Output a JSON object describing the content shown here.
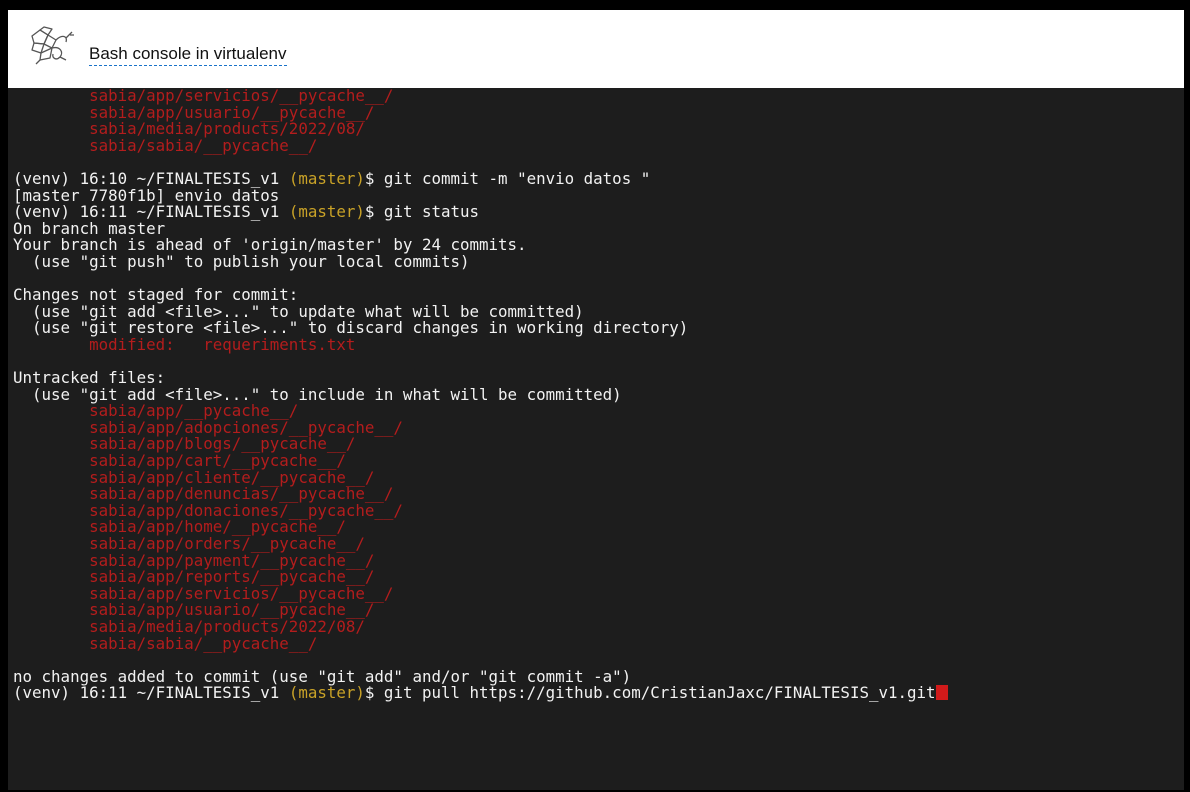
{
  "window": {
    "title": "Bash console in virtualenv",
    "logo_icon": "pythonanywhere-logo-icon"
  },
  "colors": {
    "terminal_bg": "#1d1d1d",
    "text": "#f2f2f2",
    "red": "#b31d1d",
    "yellow": "#c9a227",
    "cursor": "#d11a1a"
  },
  "terminal": {
    "lines": [
      [
        {
          "t": "        sabia/app/servicios/__pycache__/",
          "c": "red"
        }
      ],
      [
        {
          "t": "        sabia/app/usuario/__pycache__/",
          "c": "red"
        }
      ],
      [
        {
          "t": "        sabia/media/products/2022/08/",
          "c": "red"
        }
      ],
      [
        {
          "t": "        sabia/sabia/__pycache__/",
          "c": "red"
        }
      ],
      [],
      [
        {
          "t": "(venv) 16:10 ~/FINALTESIS_v1 "
        },
        {
          "t": "(master)",
          "c": "yellow"
        },
        {
          "t": "$ git commit -m \"envio datos \""
        }
      ],
      [
        {
          "t": "[master 7780f1b] envio datos"
        }
      ],
      [
        {
          "t": "(venv) 16:11 ~/FINALTESIS_v1 "
        },
        {
          "t": "(master)",
          "c": "yellow"
        },
        {
          "t": "$ git status"
        }
      ],
      [
        {
          "t": "On branch master"
        }
      ],
      [
        {
          "t": "Your branch is ahead of 'origin/master' by 24 commits."
        }
      ],
      [
        {
          "t": "  (use \"git push\" to publish your local commits)"
        }
      ],
      [],
      [
        {
          "t": "Changes not staged for commit:"
        }
      ],
      [
        {
          "t": "  (use \"git add <file>...\" to update what will be committed)"
        }
      ],
      [
        {
          "t": "  (use \"git restore <file>...\" to discard changes in working directory)"
        }
      ],
      [
        {
          "t": "        modified:   requeriments.txt",
          "c": "red"
        }
      ],
      [],
      [
        {
          "t": "Untracked files:"
        }
      ],
      [
        {
          "t": "  (use \"git add <file>...\" to include in what will be committed)"
        }
      ],
      [
        {
          "t": "        sabia/app/__pycache__/",
          "c": "red"
        }
      ],
      [
        {
          "t": "        sabia/app/adopciones/__pycache__/",
          "c": "red"
        }
      ],
      [
        {
          "t": "        sabia/app/blogs/__pycache__/",
          "c": "red"
        }
      ],
      [
        {
          "t": "        sabia/app/cart/__pycache__/",
          "c": "red"
        }
      ],
      [
        {
          "t": "        sabia/app/cliente/__pycache__/",
          "c": "red"
        }
      ],
      [
        {
          "t": "        sabia/app/denuncias/__pycache__/",
          "c": "red"
        }
      ],
      [
        {
          "t": "        sabia/app/donaciones/__pycache__/",
          "c": "red"
        }
      ],
      [
        {
          "t": "        sabia/app/home/__pycache__/",
          "c": "red"
        }
      ],
      [
        {
          "t": "        sabia/app/orders/__pycache__/",
          "c": "red"
        }
      ],
      [
        {
          "t": "        sabia/app/payment/__pycache__/",
          "c": "red"
        }
      ],
      [
        {
          "t": "        sabia/app/reports/__pycache__/",
          "c": "red"
        }
      ],
      [
        {
          "t": "        sabia/app/servicios/__pycache__/",
          "c": "red"
        }
      ],
      [
        {
          "t": "        sabia/app/usuario/__pycache__/",
          "c": "red"
        }
      ],
      [
        {
          "t": "        sabia/media/products/2022/08/",
          "c": "red"
        }
      ],
      [
        {
          "t": "        sabia/sabia/__pycache__/",
          "c": "red"
        }
      ],
      [],
      [
        {
          "t": "no changes added to commit (use \"git add\" and/or \"git commit -a\")"
        }
      ],
      [
        {
          "t": "(venv) 16:11 ~/FINALTESIS_v1 "
        },
        {
          "t": "(master)",
          "c": "yellow"
        },
        {
          "t": "$ git pull https://github.com/CristianJaxc/FINALTESIS_v1.git"
        },
        {
          "cursor": true
        }
      ]
    ]
  }
}
